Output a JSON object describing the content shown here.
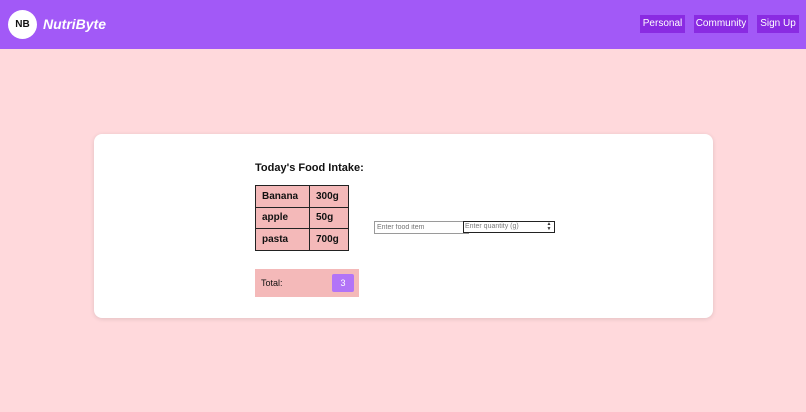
{
  "header": {
    "logo_text": "NB",
    "brand": "NutriByte",
    "nav": {
      "personal": "Personal",
      "community": "Community",
      "signup": "Sign Up"
    },
    "colors": {
      "bar": "#a259f7",
      "button": "#8a2be2"
    }
  },
  "intake": {
    "title": "Today's Food Intake:",
    "items": [
      {
        "name": "Banana",
        "quantity": "300g"
      },
      {
        "name": "apple",
        "quantity": "50g"
      },
      {
        "name": "pasta",
        "quantity": "700g"
      }
    ],
    "total_label": "Total:",
    "total_count": "3"
  },
  "form": {
    "food_placeholder": "Enter food item",
    "quantity_placeholder": "Enter quantity (g)",
    "spinner_icon": "spinner-arrows-icon"
  }
}
